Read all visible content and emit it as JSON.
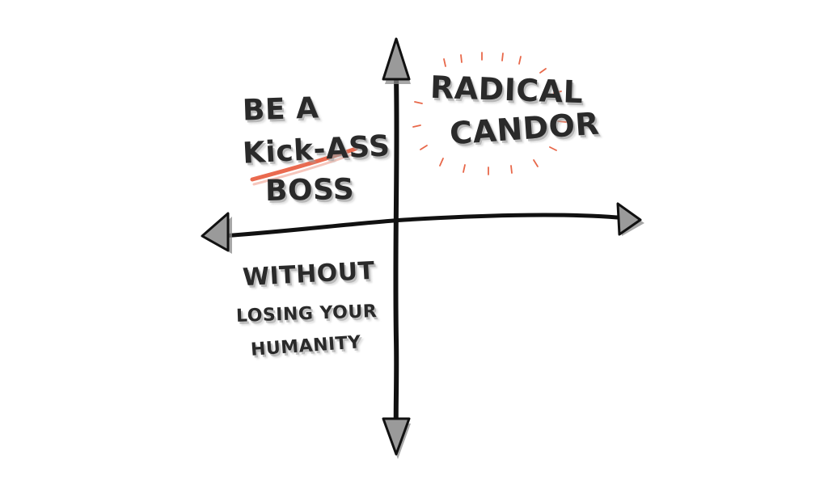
{
  "quadrants": {
    "top_left": {
      "line1": "BE A",
      "line2": "Kick-ASS",
      "line3": "BOSS"
    },
    "top_right": {
      "line1": "RADICAL",
      "line2": "CANDOR"
    },
    "bottom_left": {
      "line1": "WITHOUT",
      "line2": "LOSING YOUR",
      "line3": "HUMANITY"
    }
  },
  "colors": {
    "ink": "#111111",
    "text": "#2a2a2a",
    "shadow": "#9a9a9a",
    "accent": "#e85a3c"
  }
}
